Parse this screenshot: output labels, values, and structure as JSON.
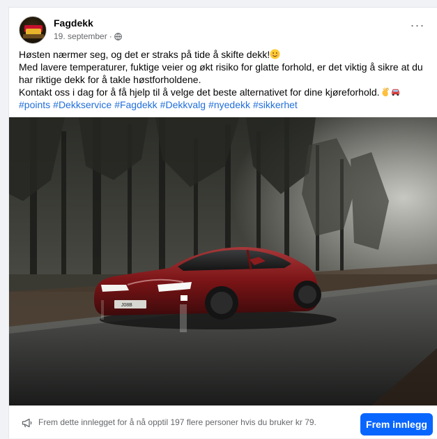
{
  "post": {
    "author": "Fagdekk",
    "date": "19. september",
    "separator": "·",
    "more_label": "···",
    "lines": [
      "Høsten nærmer seg, og det er straks på tide å skifte dekk!",
      "Med lavere temperaturer, fuktige veier og økt risiko for glatte forhold, er det viktig å sikre at du har riktige dekk for å takle høstforholdene.",
      "Kontakt oss i dag for å få hjelp til å velge det beste alternativet for dine kjøreforhold."
    ],
    "hashtags": [
      "#points",
      "#Dekkservice",
      "#Fagdekk",
      "#Dekkvalg",
      "#nyedekk",
      "#sikkerhet"
    ],
    "license_plate": "  J08B"
  },
  "promo": {
    "text": "Frem dette innlegget for å nå opptil 197 flere personer hvis du bruker kr 79.",
    "button": "Frem innlegg"
  },
  "icons": {
    "privacy": "globe-icon",
    "promo": "megaphone-icon",
    "line1_emoji": "smiling-face-emoji",
    "line3_emojis": [
      "ok-hand-emoji",
      "car-emoji"
    ]
  },
  "colors": {
    "accent": "#0866ff",
    "hashtag": "#216fdb",
    "secondary_text": "#65676b",
    "car": "#7a1416"
  }
}
